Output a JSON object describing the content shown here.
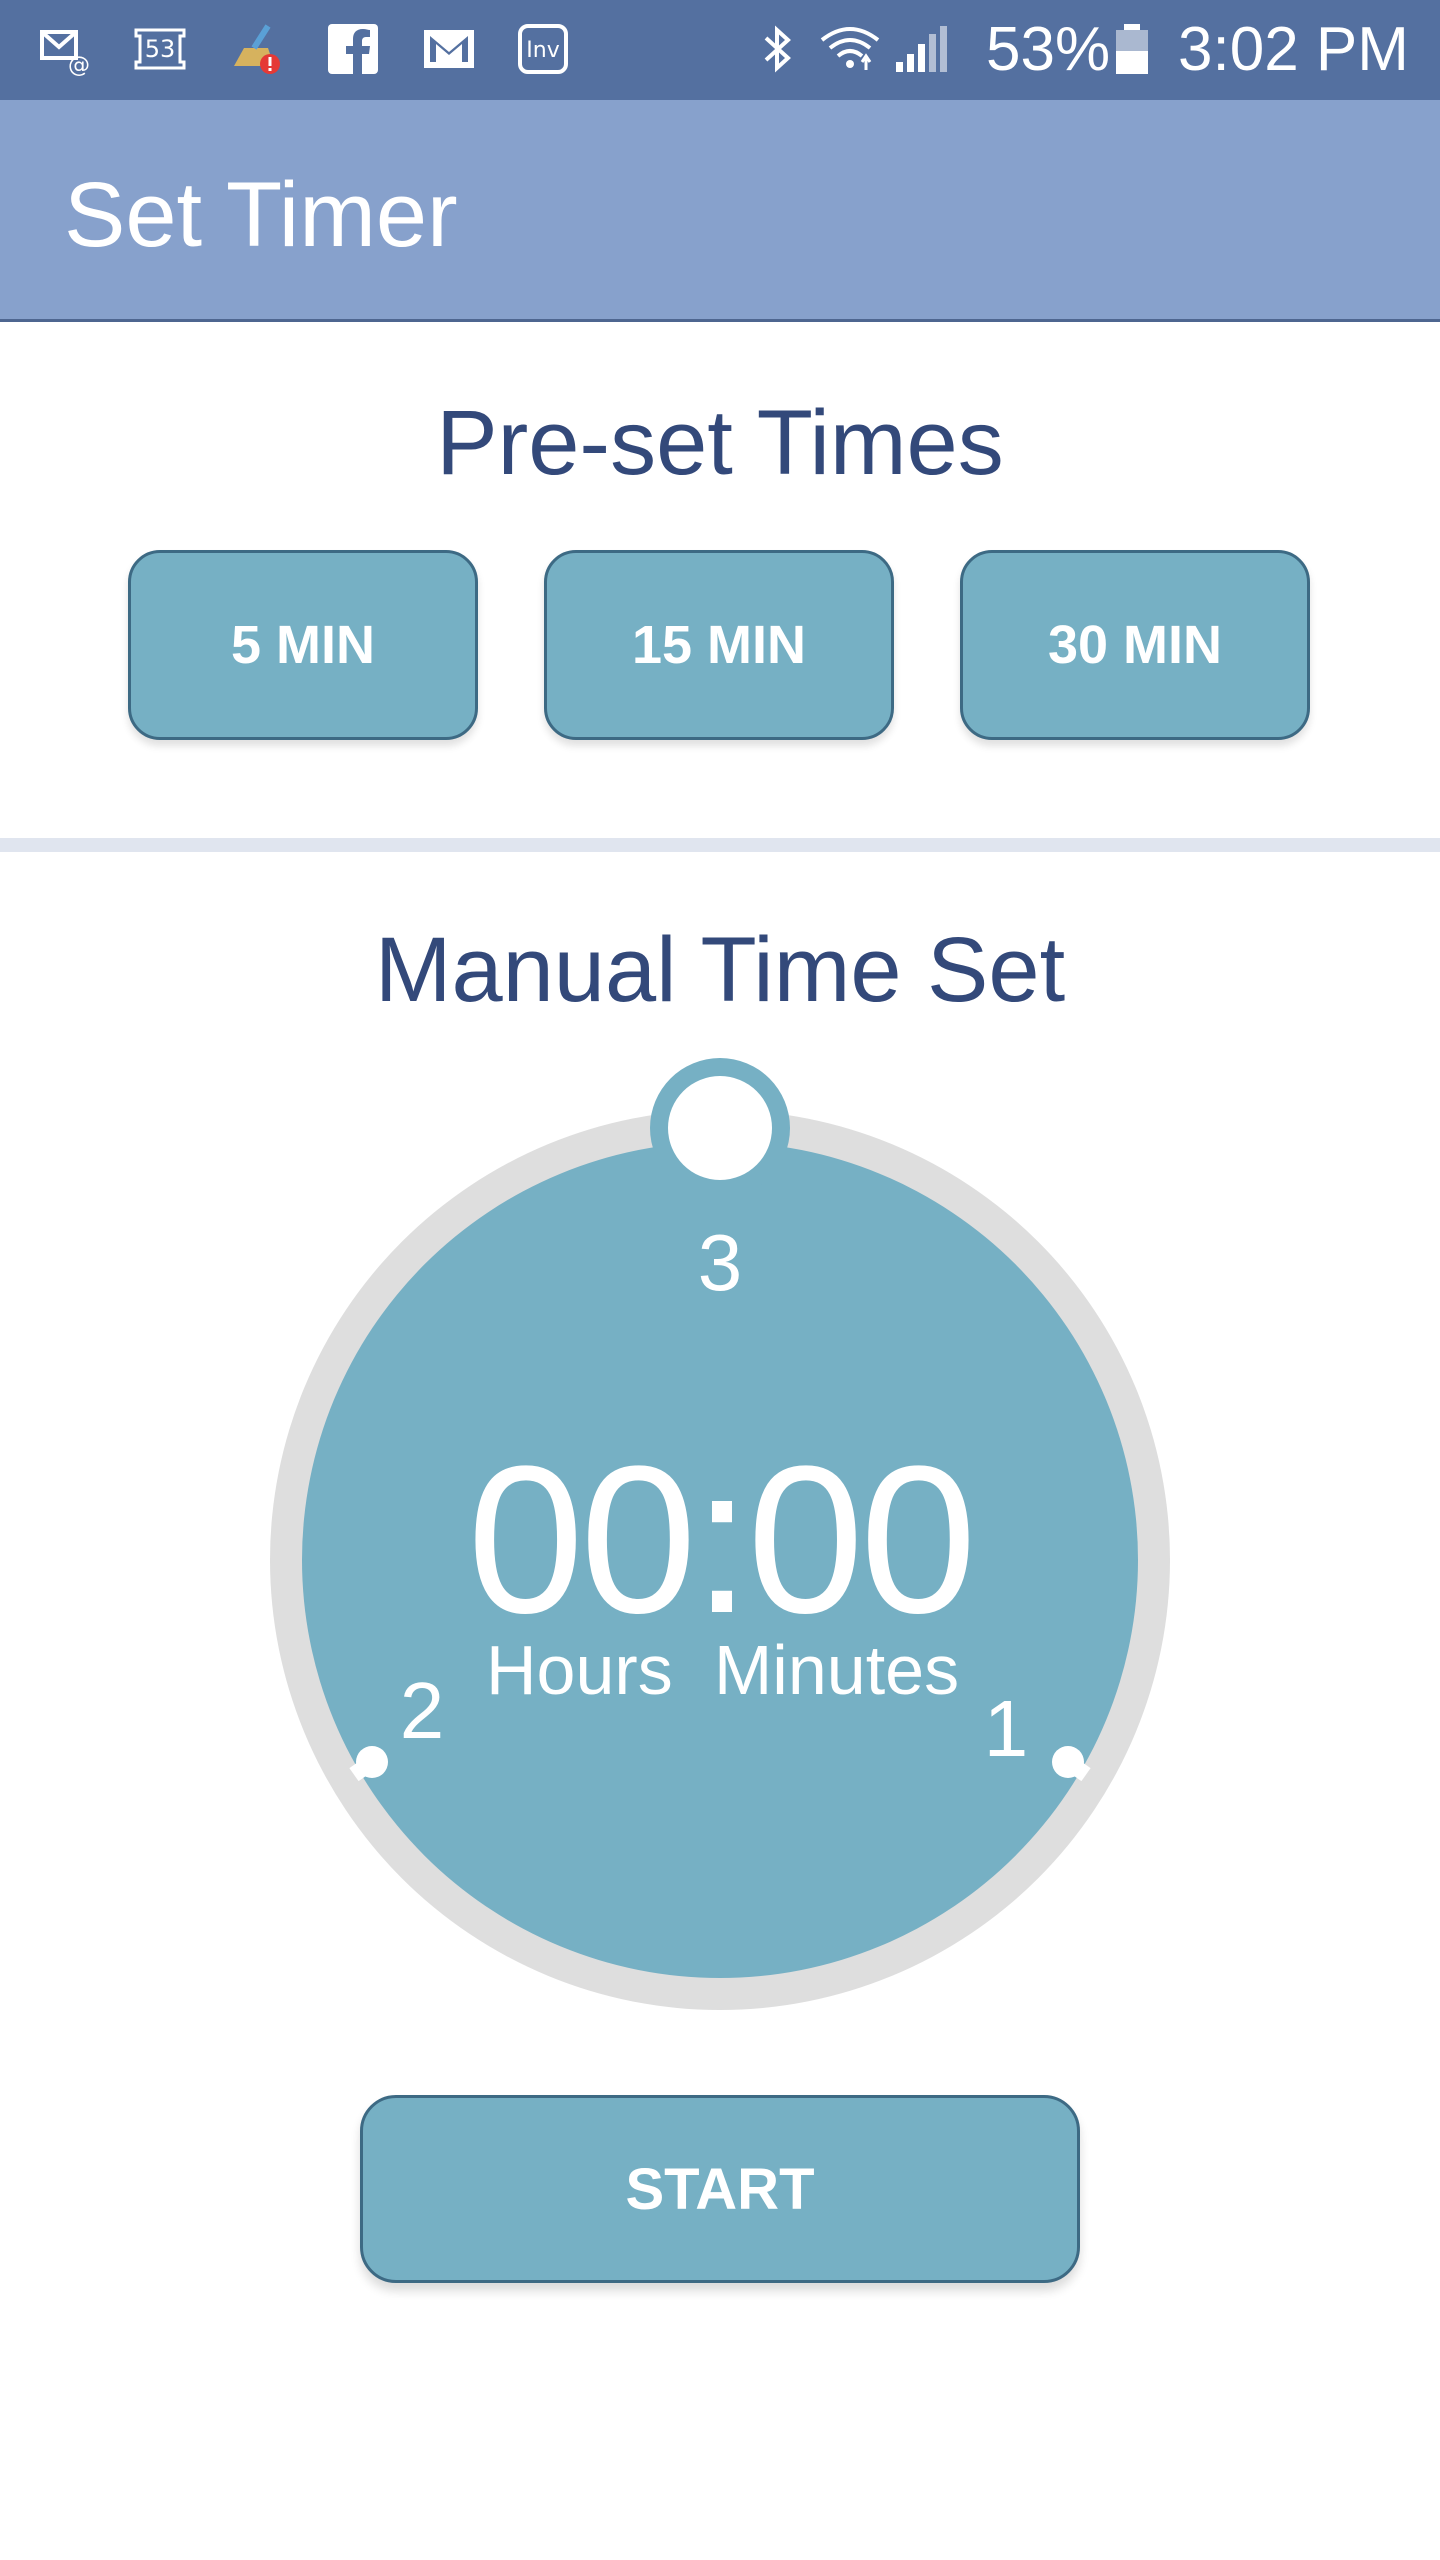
{
  "status_bar": {
    "left_icons": [
      "email-at-icon",
      "badge-53-icon",
      "cleaner-alert-icon",
      "facebook-icon",
      "gmail-icon",
      "inv-app-icon"
    ],
    "badge_count": "53",
    "inv_label": "Inv",
    "right_icons": [
      "bluetooth-icon",
      "wifi-icon",
      "signal-icon",
      "battery-icon"
    ],
    "battery_percent": "53%",
    "time": "3:02 PM"
  },
  "app_bar": {
    "title": "Set Timer"
  },
  "presets": {
    "heading": "Pre-set Times",
    "buttons": [
      {
        "label": "5 MIN"
      },
      {
        "label": "15 MIN"
      },
      {
        "label": "30 MIN"
      }
    ]
  },
  "manual": {
    "heading": "Manual Time Set",
    "dial": {
      "marks": [
        "3",
        "2",
        "1"
      ],
      "time": "00:00",
      "hours_label": "Hours",
      "minutes_label": "Minutes"
    }
  },
  "start_button": {
    "label": "START"
  },
  "colors": {
    "status_bar": "#5470a0",
    "app_bar": "#87a1cc",
    "accent": "#76b0c4",
    "heading_text": "#33497a",
    "track": "#dedede"
  }
}
